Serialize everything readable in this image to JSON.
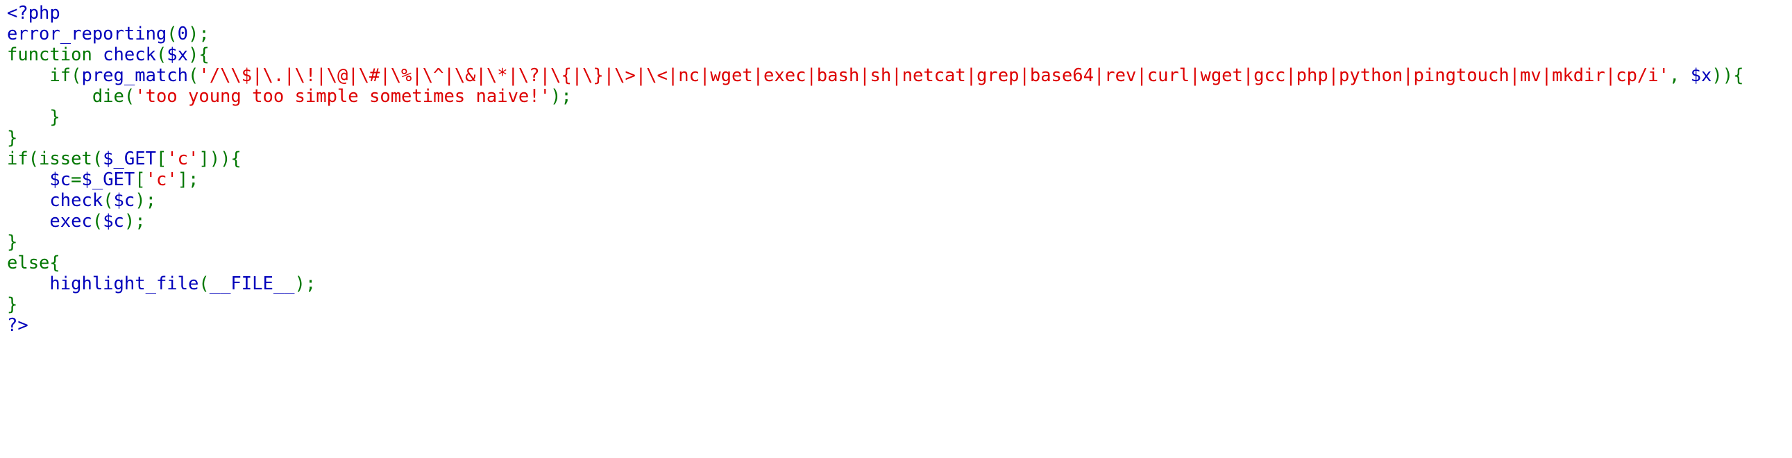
{
  "colors": {
    "default": "#0000BB",
    "keyword": "#007700",
    "string": "#DD0000",
    "background": "#FFFFFF"
  },
  "code": {
    "language": "php",
    "lines": [
      [
        {
          "t": "<?php",
          "c": "default"
        }
      ],
      [
        {
          "t": "error_reporting",
          "c": "default"
        },
        {
          "t": "(",
          "c": "keyword"
        },
        {
          "t": "0",
          "c": "default"
        },
        {
          "t": ");",
          "c": "keyword"
        }
      ],
      [
        {
          "t": "function ",
          "c": "keyword"
        },
        {
          "t": "check",
          "c": "default"
        },
        {
          "t": "(",
          "c": "keyword"
        },
        {
          "t": "$x",
          "c": "default"
        },
        {
          "t": "){",
          "c": "keyword"
        }
      ],
      [
        {
          "t": "    if(",
          "c": "keyword"
        },
        {
          "t": "preg_match",
          "c": "default"
        },
        {
          "t": "(",
          "c": "keyword"
        },
        {
          "t": "'/\\\\$|\\.|\\!|\\@|\\#|\\%|\\^|\\&|\\*|\\?|\\{|\\}|\\>|\\<|nc|wget|exec|bash|sh|netcat|grep|base64|rev|curl|wget|gcc|php|python|pingtouch|mv|mkdir|cp/i'",
          "c": "string"
        },
        {
          "t": ", ",
          "c": "keyword"
        },
        {
          "t": "$x",
          "c": "default"
        },
        {
          "t": ")){",
          "c": "keyword"
        }
      ],
      [
        {
          "t": "        die(",
          "c": "keyword"
        },
        {
          "t": "'too young too simple sometimes naive!'",
          "c": "string"
        },
        {
          "t": ");",
          "c": "keyword"
        }
      ],
      [
        {
          "t": "    }",
          "c": "keyword"
        }
      ],
      [
        {
          "t": "}",
          "c": "keyword"
        }
      ],
      [
        {
          "t": "if(isset(",
          "c": "keyword"
        },
        {
          "t": "$_GET",
          "c": "default"
        },
        {
          "t": "[",
          "c": "keyword"
        },
        {
          "t": "'c'",
          "c": "string"
        },
        {
          "t": "])){",
          "c": "keyword"
        }
      ],
      [
        {
          "t": "    ",
          "c": "keyword"
        },
        {
          "t": "$c",
          "c": "default"
        },
        {
          "t": "=",
          "c": "keyword"
        },
        {
          "t": "$_GET",
          "c": "default"
        },
        {
          "t": "[",
          "c": "keyword"
        },
        {
          "t": "'c'",
          "c": "string"
        },
        {
          "t": "];",
          "c": "keyword"
        }
      ],
      [
        {
          "t": "    ",
          "c": "keyword"
        },
        {
          "t": "check",
          "c": "default"
        },
        {
          "t": "(",
          "c": "keyword"
        },
        {
          "t": "$c",
          "c": "default"
        },
        {
          "t": ");",
          "c": "keyword"
        }
      ],
      [
        {
          "t": "    ",
          "c": "keyword"
        },
        {
          "t": "exec",
          "c": "default"
        },
        {
          "t": "(",
          "c": "keyword"
        },
        {
          "t": "$c",
          "c": "default"
        },
        {
          "t": ");",
          "c": "keyword"
        }
      ],
      [
        {
          "t": "}",
          "c": "keyword"
        }
      ],
      [
        {
          "t": "else{",
          "c": "keyword"
        }
      ],
      [
        {
          "t": "    ",
          "c": "keyword"
        },
        {
          "t": "highlight_file",
          "c": "default"
        },
        {
          "t": "(",
          "c": "keyword"
        },
        {
          "t": "__FILE__",
          "c": "default"
        },
        {
          "t": ");",
          "c": "keyword"
        }
      ],
      [
        {
          "t": "}",
          "c": "keyword"
        }
      ],
      [
        {
          "t": "?>",
          "c": "default"
        }
      ]
    ]
  }
}
